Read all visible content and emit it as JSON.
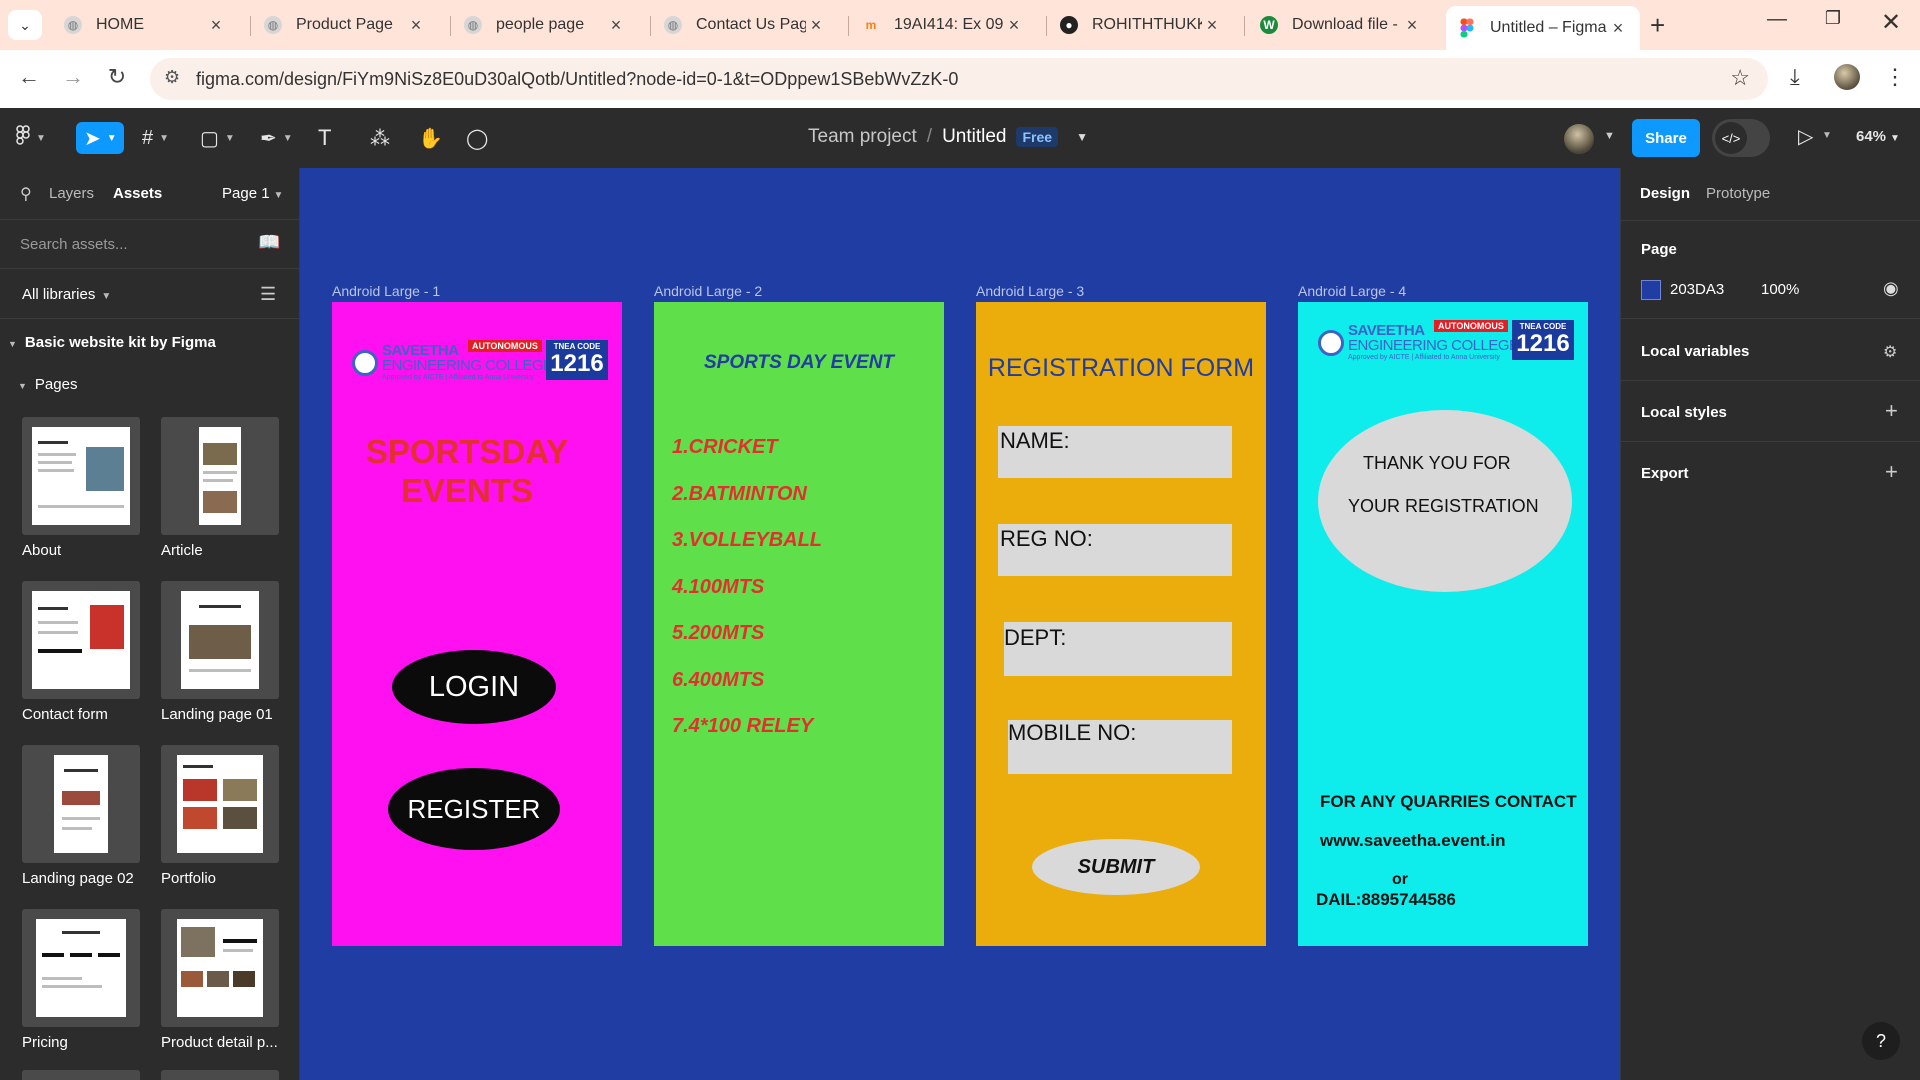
{
  "browser": {
    "tabs": [
      {
        "label": "HOME",
        "icon": "globe-icon"
      },
      {
        "label": "Product Page",
        "icon": "globe-icon"
      },
      {
        "label": "people page",
        "icon": "globe-icon"
      },
      {
        "label": "Contact Us Page",
        "icon": "globe-icon"
      },
      {
        "label": "19AI414: Ex 09 -",
        "icon": "moodle-icon"
      },
      {
        "label": "ROHITHTHUKKA",
        "icon": "github-icon"
      },
      {
        "label": "Download file - \\",
        "icon": "w-icon"
      },
      {
        "label": "Untitled – Figma",
        "icon": "figma-icon"
      }
    ],
    "url": "figma.com/design/FiYm9NiSz8E0uD30alQotb/Untitled?node-id=0-1&t=ODppew1SBebWvZzK-0"
  },
  "figma_toolbar": {
    "breadcrumb_team": "Team project",
    "breadcrumb_sep": "/",
    "file_name": "Untitled",
    "plan_badge": "Free",
    "share_label": "Share",
    "zoom": "64%"
  },
  "left_panel": {
    "tab_layers": "Layers",
    "tab_assets": "Assets",
    "page_select": "Page 1",
    "search_placeholder": "Search assets...",
    "libraries": "All libraries",
    "kit_name": "Basic website kit by Figma",
    "pages_heading": "Pages",
    "thumbnails": [
      "About",
      "Article",
      "Contact form",
      "Landing page 01",
      "Landing page 02",
      "Portfolio",
      "Pricing",
      "Product detail p..."
    ]
  },
  "canvas": {
    "background": "#203DA3",
    "frames": [
      {
        "label": "Android Large - 1",
        "color": "#FF10F0"
      },
      {
        "label": "Android Large - 2",
        "color": "#5FE04A"
      },
      {
        "label": "Android Large - 3",
        "color": "#EBAD0C"
      },
      {
        "label": "Android Large - 4",
        "color": "#0EEDEB"
      }
    ],
    "logo": {
      "name_line1": "SAVEETHA",
      "name_line2": "ENGINEERING COLLEGE",
      "badge": "AUTONOMOUS",
      "tagline": "Approved by AICTE | Affiliated to Anna University",
      "code_label": "TNEA CODE",
      "code": "1216"
    },
    "frame1": {
      "title_line1": "SPORTSDAY",
      "title_line2": "EVENTS",
      "login_label": "LOGIN",
      "register_label": "REGISTER"
    },
    "frame2": {
      "title": "SPORTS DAY EVENT",
      "items": [
        "1.CRICKET",
        "2.BATMINTON",
        "3.VOLLEYBALL",
        "4.100MTS",
        "5.200MTS",
        "6.400MTS",
        "7.4*100 RELEY"
      ]
    },
    "frame3": {
      "title": "REGISTRATION FORM",
      "fields": [
        "NAME:",
        "REG NO:",
        "DEPT:",
        "MOBILE NO:"
      ],
      "submit_label": "SUBMIT"
    },
    "frame4": {
      "thanks_line1": "THANK YOU FOR",
      "thanks_line2": "YOUR REGISTRATION",
      "contact_heading": "FOR ANY QUARRIES CONTACT",
      "website": "www.saveetha.event.in",
      "or_text": "or",
      "phone": "DAIL:8895744586"
    }
  },
  "right_panel": {
    "tab_design": "Design",
    "tab_prototype": "Prototype",
    "page_heading": "Page",
    "page_color_hex": "203DA3",
    "page_opacity": "100%",
    "local_variables": "Local variables",
    "local_styles": "Local styles",
    "export": "Export"
  }
}
